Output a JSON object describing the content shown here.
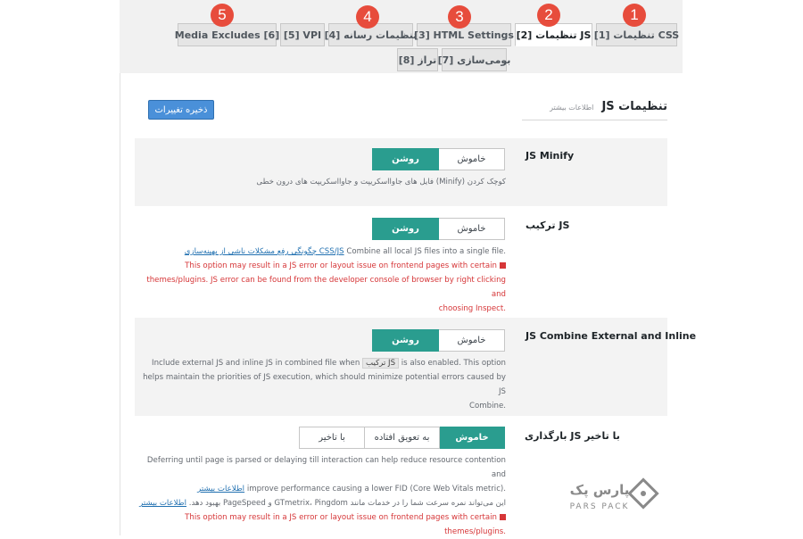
{
  "badges": [
    "1",
    "2",
    "3",
    "4",
    "5"
  ],
  "tabs": [
    {
      "label": "[1] تنظیمات CSS",
      "active": false
    },
    {
      "label": "[2] تنظیمات JS",
      "active": true
    },
    {
      "label": "[3] HTML Settings",
      "active": false
    },
    {
      "label": "[4] تنظیمات رسانه",
      "active": false
    },
    {
      "label": "[5] VPI",
      "active": false
    },
    {
      "label": "Media Excludes [6]",
      "active": false
    },
    {
      "label": "[7] بومی‌سازی",
      "active": false
    },
    {
      "label": "[8] تراز",
      "active": false
    }
  ],
  "save_label": "ذخیره تغییرات",
  "section": {
    "title": "تنظیمات JS",
    "subtitle": "اطلاعات بیشتر"
  },
  "toggle": {
    "off": "خاموش",
    "on": "روشن"
  },
  "rows": {
    "minify": {
      "label": "JS Minify",
      "desc": "کوچک کردن (Minify) فایل های جاوااسکریپت و جاوااسکریپت های درون خطی"
    },
    "combine": {
      "label": "ترکیب JS",
      "desc_a": "Combine all local JS files into a single file.",
      "desc_link": "چگونگی رفع مشکلات ناشی از بهینه‌سازی CSS/JS",
      "warn1": "This option may result in a JS error or layout issue on frontend pages with certain",
      "warn2": "themes/plugins. JS error can be found from the developer console of browser by right clicking and",
      "warn3": "choosing Inspect."
    },
    "external": {
      "label": "JS Combine External and Inline",
      "desc1_a": "Include external JS and inline JS in combined file when",
      "desc1_chip": "ترکیب JS",
      "desc1_b": "is also enabled. This option",
      "desc2": "helps maintain the priorities of JS execution, which should minimize potential errors caused by JS",
      "desc3": "Combine."
    },
    "defer": {
      "label": "بارگذاری JS با تاخیر",
      "options": [
        "خاموش",
        "به تعویق افتاده",
        "با تاخیر"
      ],
      "desc1": "Deferring until page is parsed or delaying till interaction can help reduce resource contention and",
      "desc2_a": "improve performance causing a lower FID (Core Web Vitals metric).",
      "desc2_link": "اطلاعات بیشتر",
      "desc3_a": "این می‌تواند نمره سرعت شما را در خدمات مانند GTmetrix، Pingdom و PageSpeed بهبود دهد.",
      "desc3_link": "اطلاعات بیشتر",
      "warn1": "This option may result in a JS error or layout issue on frontend pages with certain",
      "warn2": "themes/plugins."
    }
  },
  "logo": {
    "fa": "پارس پک",
    "en": "PARS PACK"
  }
}
